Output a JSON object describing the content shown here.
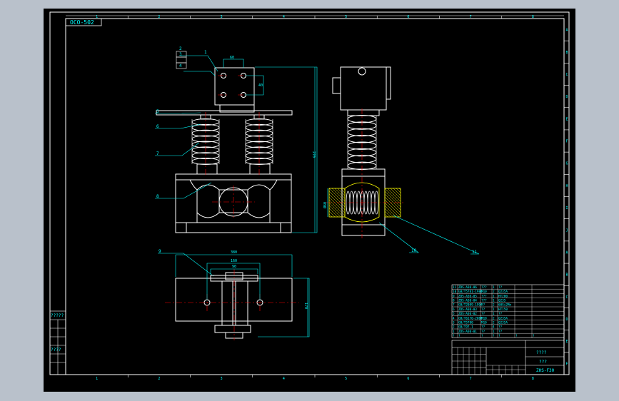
{
  "drawing": {
    "code": "OCO-502",
    "drawing_number": "ZHS-F30",
    "scale_label": "????",
    "material_label": "???",
    "left_stamp_label": "?????",
    "left_stamp_label_2": "????"
  },
  "column_numbers": [
    "1",
    "2",
    "3",
    "4",
    "5",
    "6",
    "7",
    "8"
  ],
  "row_letters": [
    "A",
    "B",
    "C",
    "D",
    "E",
    "F",
    "G",
    "H",
    "I",
    "J",
    "A",
    "B",
    "C",
    "D",
    "E",
    "F"
  ],
  "callouts": [
    "1",
    "2",
    "3",
    "4",
    "5",
    "6",
    "7",
    "8",
    "9",
    "10",
    "11"
  ],
  "dimensions": {
    "top_width": "60",
    "top_height": "40",
    "overall_height": "270",
    "base_width": "380",
    "base_inner": "160",
    "base_slot": "90",
    "base_depth": "170",
    "side_detail": "Ø60"
  },
  "bom_rows": [
    [
      "11",
      "ZDS-A30-06",
      "???",
      "1",
      "??",
      "",
      ""
    ],
    [
      "10",
      "GB/T5781-1986",
      "M10",
      "2",
      "Q235A",
      "",
      ""
    ],
    [
      "9",
      "ZDS-A30-05",
      "???",
      "1",
      "HT200",
      "",
      ""
    ],
    [
      "8",
      "ZDS-A30-04",
      "???",
      "1",
      "Q235",
      "",
      ""
    ],
    [
      "7",
      "GB/T2089-1994",
      "??",
      "2",
      "60Si2Mn",
      "",
      ""
    ],
    [
      "6",
      "ZDS-A30-03",
      "??",
      "1",
      "HT150",
      "",
      ""
    ],
    [
      "5",
      "ZDS-A30-02",
      "??",
      "1",
      "??",
      "",
      ""
    ],
    [
      "4",
      "GB/T6170-2000",
      "M10",
      "2",
      "Q235A",
      "",
      ""
    ],
    [
      "3",
      "GB/T5780",
      "M10",
      "2",
      "Q235A",
      "",
      ""
    ],
    [
      "2",
      "GB/T97.1",
      "??",
      "4",
      "??",
      "",
      ""
    ],
    [
      "1",
      "ZDS-A30-01",
      "??",
      "1",
      "??",
      "",
      ""
    ]
  ],
  "bom_header": [
    "?",
    "?",
    "?",
    "?",
    "?",
    "?",
    "?"
  ],
  "colors": {
    "frame": "#ffffff",
    "dimension": "#00ffff",
    "centerline": "#ff0000",
    "section_hatch": "#ffff00",
    "text_green": "#00ff00",
    "background": "#000000"
  }
}
